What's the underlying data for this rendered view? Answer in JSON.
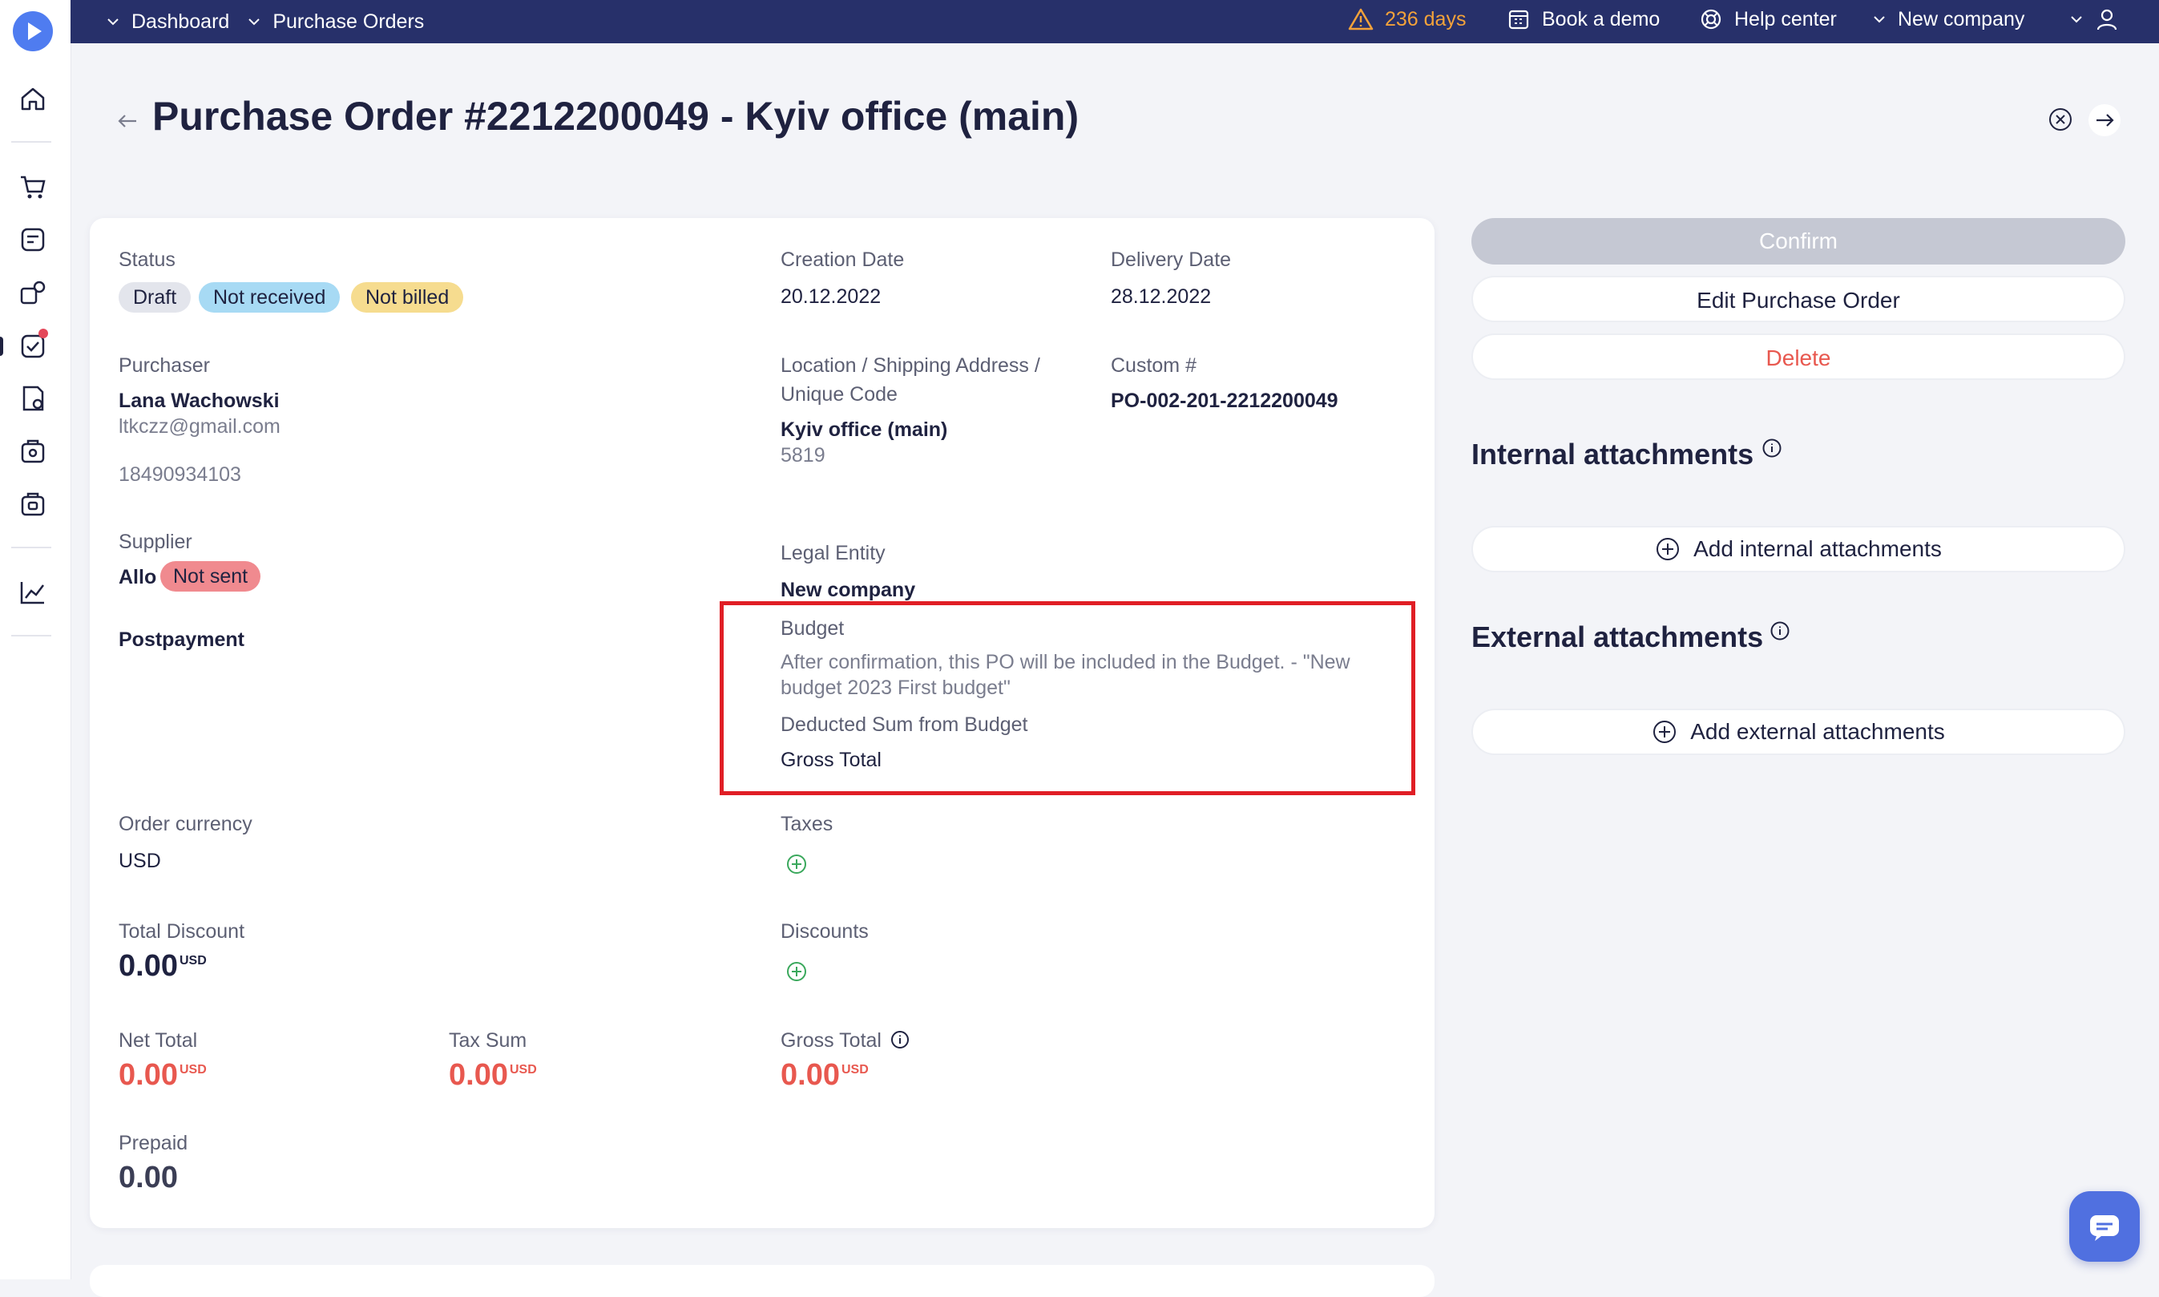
{
  "colors": {
    "topbar": "#27306a",
    "accent": "#4f7cf0",
    "danger": "#e8584f",
    "warning": "#f3a23a",
    "highlight": "#e01e25"
  },
  "breadcrumb": {
    "dashboard": "Dashboard",
    "purchase_orders": "Purchase Orders"
  },
  "topbar": {
    "trial": "236 days",
    "book_demo": "Book a demo",
    "help_center": "Help center",
    "company": "New company"
  },
  "sidebar": {
    "icons": [
      "home-icon",
      "cart-icon",
      "purchase-requests-icon",
      "suppliers-icon",
      "approvals-icon",
      "orders-icon",
      "invoices-icon",
      "payments-icon",
      "analytics-icon"
    ]
  },
  "page": {
    "title": "Purchase Order #2212200049 - Kyiv office (main)"
  },
  "order": {
    "status_label": "Status",
    "status_badges": [
      "Draft",
      "Not received",
      "Not billed"
    ],
    "creation_date_label": "Creation Date",
    "creation_date": "20.12.2022",
    "delivery_date_label": "Delivery Date",
    "delivery_date": "28.12.2022",
    "purchaser_label": "Purchaser",
    "purchaser_name": "Lana Wachowski",
    "purchaser_email": "ltkczz@gmail.com",
    "purchaser_phone": "18490934103",
    "location_label_1": "Location / Shipping Address /",
    "location_label_2": "Unique Code",
    "location_name": "Kyiv office (main)",
    "location_code": "5819",
    "custom_label": "Custom #",
    "custom_value": "PO-002-201-2212200049",
    "supplier_label": "Supplier",
    "supplier_name": "Allo",
    "supplier_badge": "Not sent",
    "legal_entity_label": "Legal Entity",
    "legal_entity": "New company",
    "payment_terms": "Postpayment",
    "budget_label": "Budget",
    "budget_note_1": "After confirmation, this PO will be included in the Budget. - \"New",
    "budget_note_2": "budget 2023 First budget\"",
    "deducted_label": "Deducted Sum from Budget",
    "deducted_value": "Gross Total",
    "currency_label": "Order currency",
    "currency": "USD",
    "taxes_label": "Taxes",
    "discounts_label": "Discounts",
    "total_discount_label": "Total Discount",
    "total_discount": "0.00",
    "net_total_label": "Net Total",
    "net_total": "0.00",
    "tax_sum_label": "Tax Sum",
    "tax_sum": "0.00",
    "gross_total_label": "Gross Total",
    "gross_total": "0.00",
    "currency_sup": "USD",
    "prepaid_label": "Prepaid",
    "prepaid": "0.00"
  },
  "actions": {
    "confirm": "Confirm",
    "edit": "Edit Purchase Order",
    "delete": "Delete"
  },
  "attachments": {
    "internal_title": "Internal attachments",
    "internal_add": "Add internal attachments",
    "external_title": "External attachments",
    "external_add": "Add external attachments"
  }
}
